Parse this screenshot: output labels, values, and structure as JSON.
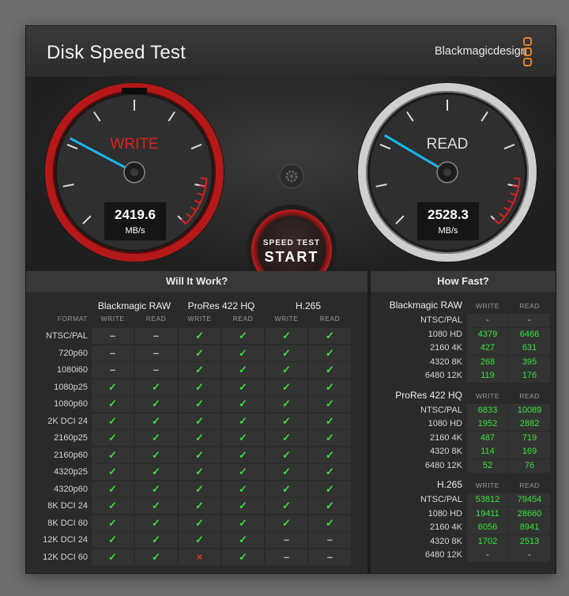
{
  "window": {
    "close_glyph": "×"
  },
  "app": {
    "title": "Disk Speed Test",
    "brand": "Blackmagicdesign"
  },
  "gauges": {
    "write": {
      "label": "WRITE",
      "value": "2419.6",
      "unit": "MB/s",
      "label_color": "#e02020",
      "needle_fraction": 0.27
    },
    "read": {
      "label": "READ",
      "value": "2528.3",
      "unit": "MB/s",
      "label_color": "#dddddd",
      "needle_fraction": 0.28
    }
  },
  "settings": {
    "icon": "gear-icon"
  },
  "start_button": {
    "line1": "SPEED TEST",
    "line2": "START"
  },
  "will_it_work": {
    "heading": "Will It Work?",
    "format_header": "FORMAT",
    "codecs": [
      "Blackmagic RAW",
      "ProRes 422 HQ",
      "H.265"
    ],
    "sub_headers": [
      "WRITE",
      "READ",
      "WRITE",
      "READ",
      "WRITE",
      "READ"
    ],
    "rows": [
      {
        "format": "NTSC/PAL",
        "marks": [
          "–",
          "–",
          "✓",
          "✓",
          "✓",
          "✓"
        ]
      },
      {
        "format": "720p60",
        "marks": [
          "–",
          "–",
          "✓",
          "✓",
          "✓",
          "✓"
        ]
      },
      {
        "format": "1080i60",
        "marks": [
          "–",
          "–",
          "✓",
          "✓",
          "✓",
          "✓"
        ]
      },
      {
        "format": "1080p25",
        "marks": [
          "✓",
          "✓",
          "✓",
          "✓",
          "✓",
          "✓"
        ]
      },
      {
        "format": "1080p60",
        "marks": [
          "✓",
          "✓",
          "✓",
          "✓",
          "✓",
          "✓"
        ]
      },
      {
        "format": "2K DCI 24",
        "marks": [
          "✓",
          "✓",
          "✓",
          "✓",
          "✓",
          "✓"
        ]
      },
      {
        "format": "2160p25",
        "marks": [
          "✓",
          "✓",
          "✓",
          "✓",
          "✓",
          "✓"
        ]
      },
      {
        "format": "2160p60",
        "marks": [
          "✓",
          "✓",
          "✓",
          "✓",
          "✓",
          "✓"
        ]
      },
      {
        "format": "4320p25",
        "marks": [
          "✓",
          "✓",
          "✓",
          "✓",
          "✓",
          "✓"
        ]
      },
      {
        "format": "4320p60",
        "marks": [
          "✓",
          "✓",
          "✓",
          "✓",
          "✓",
          "✓"
        ]
      },
      {
        "format": "8K DCI 24",
        "marks": [
          "✓",
          "✓",
          "✓",
          "✓",
          "✓",
          "✓"
        ]
      },
      {
        "format": "8K DCI 60",
        "marks": [
          "✓",
          "✓",
          "✓",
          "✓",
          "✓",
          "✓"
        ]
      },
      {
        "format": "12K DCI 24",
        "marks": [
          "✓",
          "✓",
          "✓",
          "✓",
          "–",
          "–"
        ]
      },
      {
        "format": "12K DCI 60",
        "marks": [
          "✓",
          "✓",
          "×",
          "✓",
          "–",
          "–"
        ]
      }
    ],
    "colors": {
      "check": "#3ee03e",
      "dash": "#bbbbbb",
      "cross": "#e03a2a"
    }
  },
  "how_fast": {
    "heading": "How Fast?",
    "groups": [
      {
        "codec": "Blackmagic RAW",
        "sub_headers": [
          "WRITE",
          "READ"
        ],
        "rows": [
          {
            "format": "NTSC/PAL",
            "write": "-",
            "read": "-"
          },
          {
            "format": "1080 HD",
            "write": "4379",
            "read": "6466"
          },
          {
            "format": "2160 4K",
            "write": "427",
            "read": "631"
          },
          {
            "format": "4320 8K",
            "write": "268",
            "read": "395"
          },
          {
            "format": "6480 12K",
            "write": "119",
            "read": "176"
          }
        ]
      },
      {
        "codec": "ProRes 422 HQ",
        "sub_headers": [
          "WRITE",
          "READ"
        ],
        "rows": [
          {
            "format": "NTSC/PAL",
            "write": "6833",
            "read": "10089"
          },
          {
            "format": "1080 HD",
            "write": "1952",
            "read": "2882"
          },
          {
            "format": "2160 4K",
            "write": "487",
            "read": "719"
          },
          {
            "format": "4320 8K",
            "write": "114",
            "read": "169"
          },
          {
            "format": "6480 12K",
            "write": "52",
            "read": "76"
          }
        ]
      },
      {
        "codec": "H.265",
        "sub_headers": [
          "WRITE",
          "READ"
        ],
        "rows": [
          {
            "format": "NTSC/PAL",
            "write": "53812",
            "read": "79454"
          },
          {
            "format": "1080 HD",
            "write": "19411",
            "read": "28660"
          },
          {
            "format": "2160 4K",
            "write": "6056",
            "read": "8941"
          },
          {
            "format": "4320 8K",
            "write": "1702",
            "read": "2513"
          },
          {
            "format": "6480 12K",
            "write": "-",
            "read": "-"
          }
        ]
      }
    ],
    "value_color": "#39e63a"
  }
}
